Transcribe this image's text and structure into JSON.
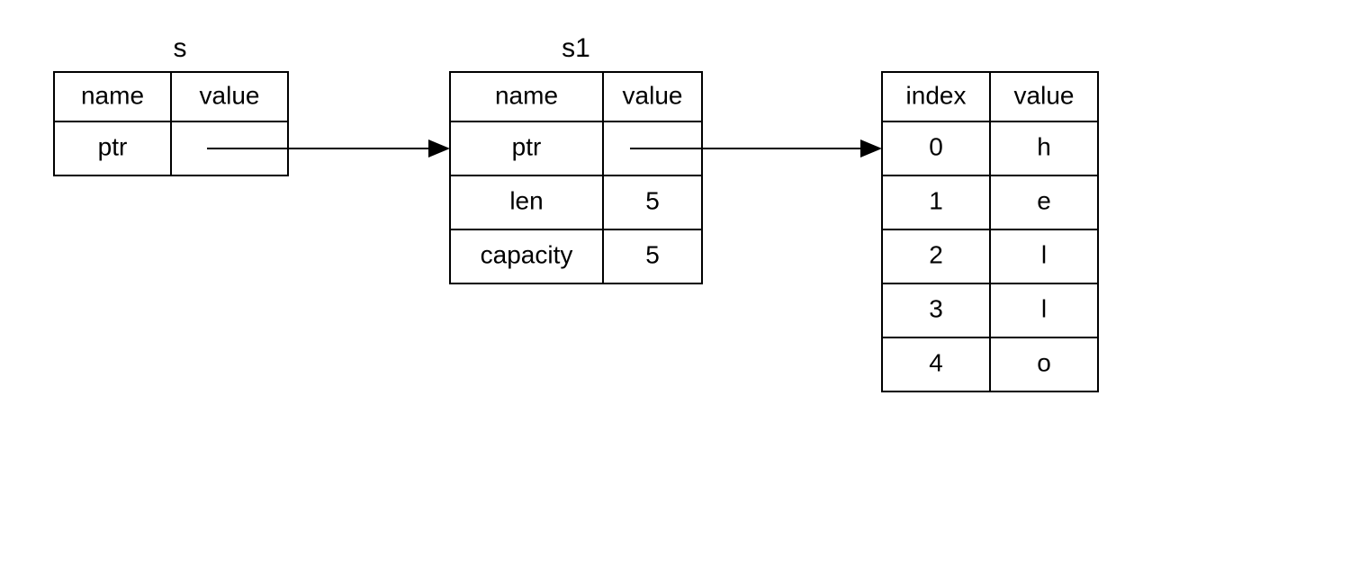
{
  "tables": {
    "s": {
      "title": "s",
      "headers": [
        "name",
        "value"
      ],
      "rows": [
        {
          "name": "ptr",
          "value": ""
        }
      ]
    },
    "s1": {
      "title": "s1",
      "headers": [
        "name",
        "value"
      ],
      "rows": [
        {
          "name": "ptr",
          "value": ""
        },
        {
          "name": "len",
          "value": "5"
        },
        {
          "name": "capacity",
          "value": "5"
        }
      ]
    },
    "heap": {
      "headers": [
        "index",
        "value"
      ],
      "rows": [
        {
          "index": "0",
          "value": "h"
        },
        {
          "index": "1",
          "value": "e"
        },
        {
          "index": "2",
          "value": "l"
        },
        {
          "index": "3",
          "value": "l"
        },
        {
          "index": "4",
          "value": "o"
        }
      ]
    }
  }
}
